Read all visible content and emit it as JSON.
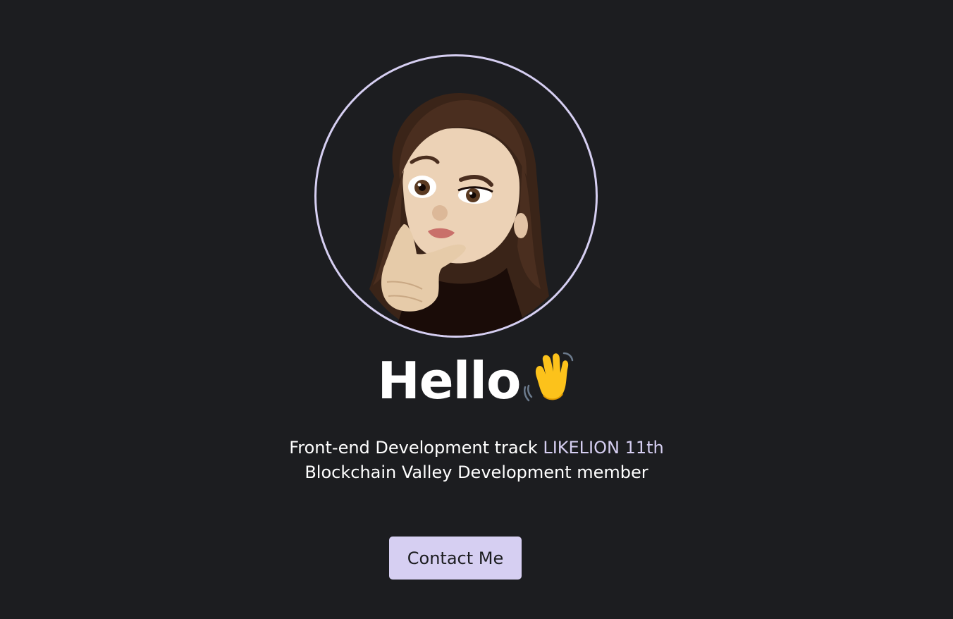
{
  "profile": {
    "avatar_icon": "memoji-thinking-icon",
    "greeting": "Hello",
    "greeting_icon": "waving-hand-icon"
  },
  "intro": {
    "line1_text": "Front-end Development track ",
    "line1_accent": "LIKELION 11th",
    "line2_text": "Blockchain Valley Development member"
  },
  "actions": {
    "contact_label": "Contact Me"
  },
  "colors": {
    "background": "#1c1d20",
    "accent": "#d6cff2",
    "text": "#ffffff"
  }
}
